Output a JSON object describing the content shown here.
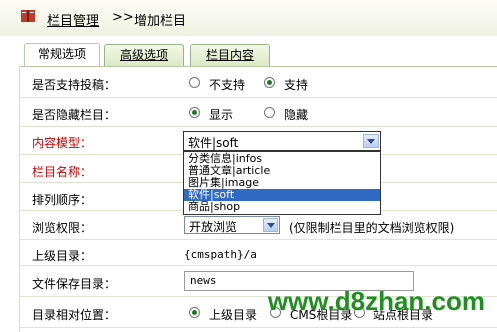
{
  "breadcrumb": {
    "root": "栏目管理",
    "separator": ">>",
    "current": "增加栏目"
  },
  "tabs": [
    "常规选项",
    "高级选项",
    "栏目内容"
  ],
  "form": {
    "contribute": {
      "label": "是否支持投稿：",
      "options": [
        "不支持",
        "支持"
      ],
      "selected": "支持"
    },
    "hidden": {
      "label": "是否隐藏栏目：",
      "options": [
        "显示",
        "隐藏"
      ],
      "selected": "显示"
    },
    "model": {
      "label": "内容模型：",
      "value": "软件|soft",
      "options": [
        "分类信息|infos",
        "普通文章|article",
        "图片集|image",
        "软件|soft",
        "商品|shop"
      ],
      "highlighted": "软件|soft"
    },
    "name": {
      "label": "栏目名称："
    },
    "order": {
      "label": "排列顺序："
    },
    "permission": {
      "label": "浏览权限：",
      "value": "开放浏览",
      "note": "(仅限制栏目里的文档浏览权限)"
    },
    "parent_dir": {
      "label": "上级目录：",
      "value": "{cmspath}/a"
    },
    "save_dir": {
      "label": "文件保存目录：",
      "value": "news"
    },
    "relative": {
      "label": "目录相对位置：",
      "options": [
        "上级目录",
        "CMS根目录",
        "站点根目录"
      ],
      "selected": "上级目录"
    }
  },
  "watermark": "www.d8zhan.com",
  "colors": {
    "required_label": "#cc0000",
    "highlight": "#316ac5",
    "watermark": "#1f8f1f"
  }
}
